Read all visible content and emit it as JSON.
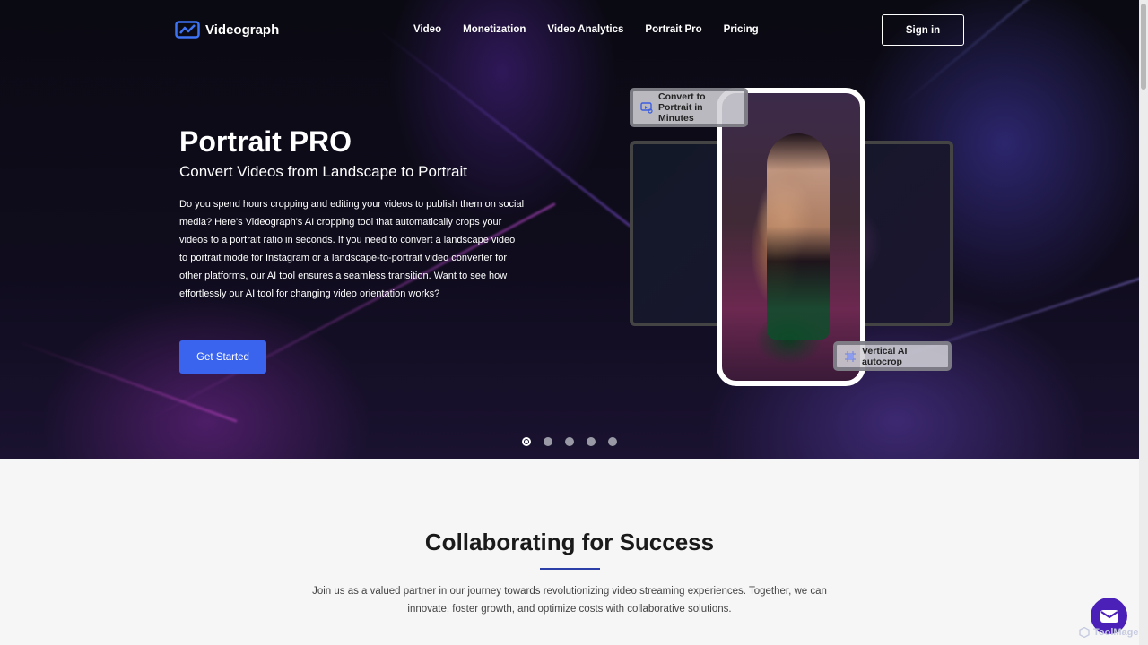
{
  "nav": {
    "logo_text": "Videograph",
    "items": [
      "Video",
      "Monetization",
      "Video Analytics",
      "Portrait Pro",
      "Pricing"
    ],
    "signin_label": "Sign in"
  },
  "hero": {
    "title": "Portrait PRO",
    "subtitle": "Convert Videos from Landscape to Portrait",
    "body": "Do you spend hours cropping and editing your videos to publish them on social media? Here's Videograph's AI cropping tool that automatically crops your videos to a portrait ratio in seconds. If you need to convert a landscape video to portrait mode for Instagram or a landscape-to-portrait video converter for other platforms, our AI tool ensures a seamless transition. Want to see how effortlessly our AI tool for changing video orientation works?",
    "cta_label": "Get Started",
    "badge_top": "Convert to Portrait in Minutes",
    "badge_bottom": "Vertical AI autocrop",
    "slides_total": 5,
    "active_slide": 1
  },
  "section": {
    "title": "Collaborating for Success",
    "body": "Join us as a valued partner in our journey towards revolutionizing video streaming experiences. Together, we can innovate, foster growth, and optimize costs with collaborative solutions."
  },
  "widget": {
    "watermark": "ToolMage"
  },
  "colors": {
    "accent": "#3a63ee",
    "chat": "#4a20b8",
    "rule": "#2c3ea8"
  }
}
